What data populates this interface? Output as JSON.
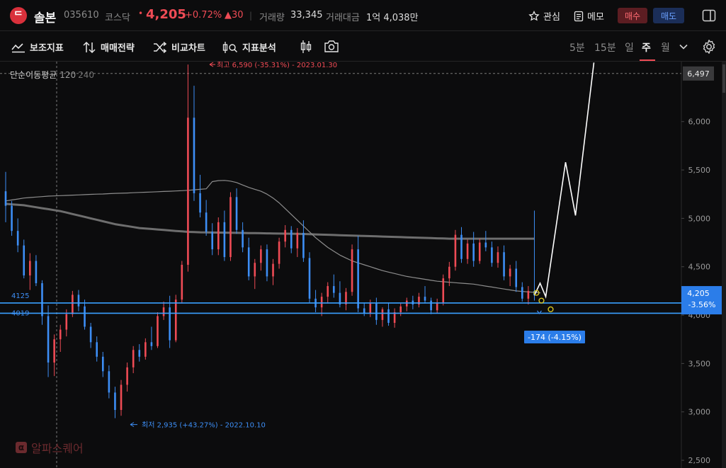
{
  "header": {
    "logo_glyph": "ᄃ",
    "name": "솔본",
    "code": "035610",
    "market": "코스닥",
    "dot": "•",
    "price": "4,205",
    "change_pct": "+0.72%",
    "change_abs": "▲30",
    "volume_label": "거래량",
    "volume": "33,345",
    "amount_label": "거래대금",
    "amount": "1억 4,038만",
    "watch_label": "관심",
    "memo_label": "메모",
    "buy_label": "매수",
    "sell_label": "매도"
  },
  "toolbar": {
    "indicators_label": "보조지표",
    "strategy_label": "매매전략",
    "compare_label": "비교차트",
    "analysis_label": "지표분석",
    "periods": [
      "5분",
      "15분",
      "일",
      "주",
      "월"
    ],
    "active_period": "주"
  },
  "indicator": {
    "name": "단순이동평균",
    "p1": "120",
    "p2": "240"
  },
  "watermark": {
    "icon": "α",
    "text": "알파스퀘어"
  },
  "colors": {
    "up": "#ef4b55",
    "down": "#3d8ef5",
    "ma120": "#8d8d8d",
    "ma240": "#6e6e6e",
    "level": "#3aa0ff",
    "forecast": "#ffffff",
    "marker": "#d6c521"
  },
  "chart_data": {
    "type": "candlestick",
    "title": "",
    "y_ticks": [
      2500,
      3000,
      3500,
      4000,
      4500,
      5000,
      5500,
      6000
    ],
    "y_tick_labels": [
      "2,500",
      "3,000",
      "3,500",
      "4,000",
      "4,500",
      "5,000",
      "5,500",
      "6,000"
    ],
    "ylim": [
      2420,
      6620
    ],
    "price_tag": {
      "value": 6497,
      "label": "6,497"
    },
    "current_tag": {
      "value": 4205,
      "label": "4,205",
      "sub": "-3.56%"
    },
    "levels": [
      {
        "value": 4125,
        "label": "4125"
      },
      {
        "value": 4019,
        "label": "4019"
      }
    ],
    "diff_label": "-174 (-4.15%)",
    "high_annotation": "최고 6,590 (-35.31%) - 2023.01.30",
    "low_annotation": "최저 2,935 (+43.27%) - 2022.10.10",
    "candles": [
      [
        5280,
        5480,
        4960,
        5130
      ],
      [
        5130,
        5180,
        4820,
        4870
      ],
      [
        4870,
        5000,
        4650,
        4720
      ],
      [
        4720,
        4780,
        4380,
        4410
      ],
      [
        4410,
        4640,
        4260,
        4560
      ],
      [
        4560,
        4620,
        4300,
        4330
      ],
      [
        4330,
        4360,
        3900,
        3990
      ],
      [
        3990,
        4100,
        3360,
        3510
      ],
      [
        3510,
        3800,
        3370,
        3750
      ],
      [
        3750,
        3900,
        3620,
        3850
      ],
      [
        3850,
        4060,
        3780,
        4010
      ],
      [
        4010,
        4250,
        3980,
        4210
      ],
      [
        4210,
        4260,
        4040,
        4090
      ],
      [
        4090,
        4160,
        3850,
        3880
      ],
      [
        3880,
        3920,
        3660,
        3720
      ],
      [
        3720,
        3780,
        3520,
        3570
      ],
      [
        3570,
        3620,
        3360,
        3420
      ],
      [
        3420,
        3480,
        3140,
        3200
      ],
      [
        3200,
        3260,
        2935,
        3020
      ],
      [
        3020,
        3330,
        2960,
        3280
      ],
      [
        3280,
        3510,
        3210,
        3460
      ],
      [
        3460,
        3680,
        3400,
        3640
      ],
      [
        3640,
        3700,
        3520,
        3570
      ],
      [
        3570,
        3760,
        3540,
        3720
      ],
      [
        3720,
        3880,
        3640,
        3680
      ],
      [
        3680,
        4030,
        3660,
        3990
      ],
      [
        3990,
        4140,
        3950,
        4080
      ],
      [
        4080,
        4200,
        3660,
        3740
      ],
      [
        3740,
        4210,
        3720,
        4160
      ],
      [
        4160,
        4560,
        4120,
        4520
      ],
      [
        4520,
        6590,
        4450,
        6040
      ],
      [
        6040,
        6370,
        5180,
        5260
      ],
      [
        5260,
        5450,
        5010,
        5060
      ],
      [
        5060,
        5190,
        4820,
        4860
      ],
      [
        4860,
        4950,
        4620,
        4680
      ],
      [
        4680,
        5010,
        4620,
        4960
      ],
      [
        4960,
        5080,
        4560,
        4600
      ],
      [
        4600,
        5270,
        4560,
        5220
      ],
      [
        5220,
        5310,
        4840,
        4880
      ],
      [
        4880,
        4960,
        4650,
        4700
      ],
      [
        4700,
        4800,
        4360,
        4400
      ],
      [
        4400,
        4580,
        4270,
        4540
      ],
      [
        4540,
        4720,
        4460,
        4680
      ],
      [
        4680,
        4730,
        4350,
        4400
      ],
      [
        4400,
        4580,
        4310,
        4530
      ],
      [
        4530,
        4800,
        4480,
        4760
      ],
      [
        4760,
        4930,
        4700,
        4880
      ],
      [
        4880,
        4920,
        4640,
        4690
      ],
      [
        4690,
        4900,
        4600,
        4850
      ],
      [
        4850,
        4980,
        4550,
        4590
      ],
      [
        4590,
        4650,
        4130,
        4170
      ],
      [
        4170,
        4260,
        4030,
        4080
      ],
      [
        4080,
        4230,
        3990,
        4190
      ],
      [
        4190,
        4340,
        4120,
        4300
      ],
      [
        4300,
        4420,
        4180,
        4230
      ],
      [
        4230,
        4350,
        4080,
        4110
      ],
      [
        4110,
        4280,
        4050,
        4240
      ],
      [
        4240,
        4730,
        4200,
        4680
      ],
      [
        4680,
        4820,
        4030,
        4070
      ],
      [
        4070,
        4130,
        3990,
        4020
      ],
      [
        4020,
        4160,
        3980,
        4120
      ],
      [
        4120,
        4180,
        3900,
        3950
      ],
      [
        3950,
        4080,
        3880,
        4060
      ],
      [
        4060,
        4130,
        3890,
        3920
      ],
      [
        3920,
        4070,
        3870,
        4030
      ],
      [
        4030,
        4120,
        3990,
        4090
      ],
      [
        4090,
        4180,
        4040,
        4150
      ],
      [
        4150,
        4200,
        4060,
        4110
      ],
      [
        4110,
        4230,
        4080,
        4190
      ],
      [
        4190,
        4300,
        4120,
        4150
      ],
      [
        4150,
        4180,
        4010,
        4050
      ],
      [
        4050,
        4170,
        4020,
        4130
      ],
      [
        4130,
        4420,
        4100,
        4380
      ],
      [
        4380,
        4550,
        4300,
        4500
      ],
      [
        4500,
        4880,
        4460,
        4830
      ],
      [
        4830,
        4910,
        4540,
        4580
      ],
      [
        4580,
        4780,
        4530,
        4740
      ],
      [
        4740,
        4860,
        4500,
        4560
      ],
      [
        4560,
        4790,
        4530,
        4750
      ],
      [
        4750,
        4870,
        4660,
        4700
      ],
      [
        4700,
        4760,
        4500,
        4540
      ],
      [
        4540,
        4710,
        4490,
        4650
      ],
      [
        4650,
        4720,
        4360,
        4400
      ],
      [
        4400,
        4520,
        4300,
        4480
      ],
      [
        4480,
        4560,
        4240,
        4290
      ],
      [
        4290,
        4340,
        4140,
        4170
      ],
      [
        4170,
        4300,
        4110,
        4250
      ],
      [
        4250,
        5080,
        4150,
        4205
      ]
    ],
    "ma120": [
      5180,
      5190,
      5200,
      5210,
      5215,
      5220,
      5225,
      5230,
      5232,
      5235,
      5237,
      5240,
      5242,
      5245,
      5248,
      5250,
      5252,
      5255,
      5258,
      5260,
      5262,
      5265,
      5268,
      5270,
      5272,
      5275,
      5278,
      5280,
      5283,
      5286,
      5290,
      5295,
      5300,
      5305,
      5380,
      5390,
      5392,
      5385,
      5370,
      5345,
      5320,
      5300,
      5280,
      5250,
      5210,
      5160,
      5100,
      5040,
      4980,
      4920,
      4860,
      4800,
      4750,
      4700,
      4660,
      4620,
      4590,
      4560,
      4540,
      4520,
      4500,
      4480,
      4460,
      4445,
      4430,
      4415,
      4400,
      4390,
      4380,
      4370,
      4360,
      4350,
      4345,
      4340,
      4335,
      4330,
      4325,
      4320,
      4310,
      4300,
      4290,
      4280,
      4270,
      4260,
      4250,
      4245,
      4240,
      4235,
      4230
    ],
    "ma240": [
      5150,
      5145,
      5140,
      5135,
      5125,
      5115,
      5105,
      5095,
      5085,
      5075,
      5060,
      5045,
      5030,
      5015,
      5000,
      4985,
      4970,
      4955,
      4940,
      4930,
      4920,
      4910,
      4900,
      4895,
      4890,
      4885,
      4880,
      4875,
      4870,
      4865,
      4860,
      4858,
      4856,
      4855,
      4854,
      4853,
      4852,
      4851,
      4850,
      4849,
      4848,
      4847,
      4846,
      4845,
      4844,
      4843,
      4842,
      4841,
      4840,
      4838,
      4836,
      4834,
      4832,
      4830,
      4828,
      4826,
      4824,
      4822,
      4820,
      4818,
      4816,
      4814,
      4812,
      4810,
      4808,
      4806,
      4804,
      4802,
      4800,
      4798,
      4796,
      4794,
      4792,
      4790,
      4790,
      4790,
      4790,
      4790,
      4790,
      4790,
      4790,
      4790,
      4790,
      4790,
      4790,
      4790,
      4790,
      4790
    ],
    "forecast": [
      4205,
      4330,
      4190,
      5580,
      5030,
      6610
    ],
    "markers": [
      4230,
      4150,
      4060
    ]
  }
}
